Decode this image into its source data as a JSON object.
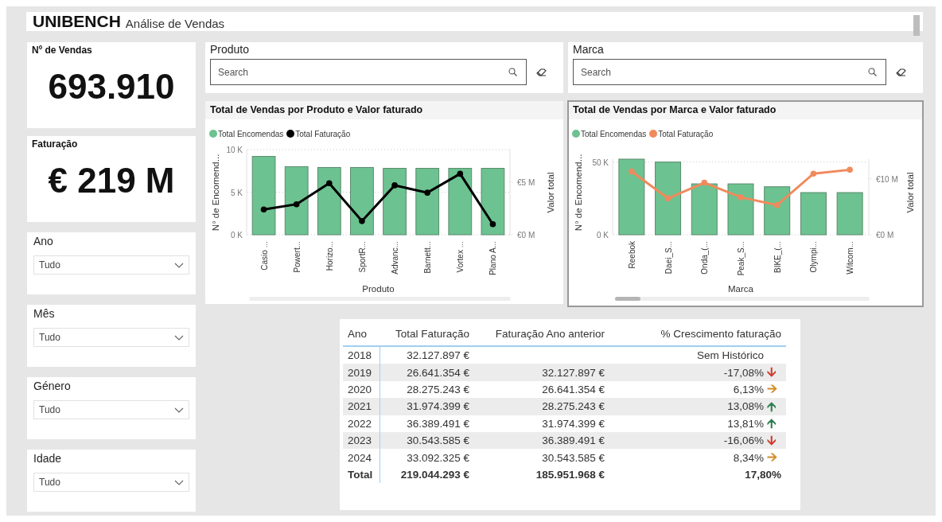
{
  "header": {
    "brand": "UNIBENCH",
    "title": "Análise de Vendas"
  },
  "cards": [
    {
      "label": "Nº de Vendas",
      "value": "693.910"
    },
    {
      "label": "Faturação",
      "value": "€ 219 M"
    }
  ],
  "slicers": [
    {
      "label": "Ano",
      "value": "Tudo"
    },
    {
      "label": "Mês",
      "value": "Tudo"
    },
    {
      "label": "Género",
      "value": "Tudo"
    },
    {
      "label": "Idade",
      "value": "Tudo"
    }
  ],
  "search_slicers": [
    {
      "label": "Produto",
      "placeholder": "Search"
    },
    {
      "label": "Marca",
      "placeholder": "Search"
    }
  ],
  "charts": [
    {
      "selected": false,
      "title": "Total de Vendas por Produto e Valor faturado",
      "layers": [
        {
          "chart_data": {
            "type": "bar",
            "xlabel": "Produto",
            "ylabel": "N° de Encomend...",
            "categories": [
              "Casio ...",
              "Powert...",
              "Horizo...",
              "SportR...",
              "Advanc...",
              "Barnett...",
              "Vortex ...",
              "Plano A..."
            ],
            "ylim": [
              0,
              10000
            ],
            "yticks": [
              {
                "value": 0,
                "label": "0 K"
              },
              {
                "value": 5000,
                "label": "5 K"
              },
              {
                "value": 10000,
                "label": "10 K"
              }
            ],
            "stacked": false,
            "series": [
              {
                "name": "Total Encomendas",
                "color": "#6cc290",
                "values": [
                  9200,
                  8000,
                  7900,
                  7900,
                  7800,
                  7800,
                  7800,
                  7800
                ]
              }
            ]
          }
        },
        {
          "chart_data": {
            "type": "line",
            "ylabel": "Valor total",
            "ylim": [
              0,
              8.1
            ],
            "yticks": [
              {
                "value": 0,
                "label": "€0 M"
              },
              {
                "value": 5,
                "label": "€5 M"
              }
            ],
            "series": [
              {
                "name": "Total Faturação",
                "color": "#000000",
                "marker": "o",
                "values": [
                  2.4,
                  2.9,
                  4.9,
                  1.3,
                  4.7,
                  4.0,
                  5.8,
                  1.0
                ]
              }
            ]
          }
        }
      ]
    },
    {
      "selected": true,
      "title": "Total de Vendas por Marca e Valor faturado",
      "layers": [
        {
          "chart_data": {
            "type": "bar",
            "xlabel": "Marca",
            "ylabel": "N° de Encomend...",
            "categories": [
              "Reebok",
              "Daei_S...",
              "Onda_(...",
              "Peak_S...",
              "BIKE_(...",
              "Olympi...",
              "Witcom..."
            ],
            "ylim": [
              0,
              52000
            ],
            "yticks": [
              {
                "value": 0,
                "label": "0 K"
              },
              {
                "value": 50000,
                "label": "50 K"
              }
            ],
            "stacked": false,
            "series": [
              {
                "name": "Total Encomendas",
                "color": "#6cc290",
                "values": [
                  52000,
                  50000,
                  35000,
                  35000,
                  33000,
                  29000,
                  29000
                ]
              }
            ]
          }
        },
        {
          "chart_data": {
            "type": "line",
            "ylabel": "Valor total",
            "ylim": [
              0,
              13.5
            ],
            "yticks": [
              {
                "value": 0,
                "label": "€0 M"
              },
              {
                "value": 10,
                "label": "€10 M"
              }
            ],
            "series": [
              {
                "name": "Total Faturação",
                "color": "#f08a5d",
                "marker": "o",
                "values": [
                  11.3,
                  6.5,
                  9.3,
                  6.7,
                  5.3,
                  10.9,
                  11.6
                ]
              }
            ]
          }
        }
      ]
    }
  ],
  "table": {
    "columns": [
      "Ano",
      "Total Faturação",
      "Faturação Ano anterior",
      "% Crescimento faturação"
    ],
    "rows": [
      {
        "cells": [
          "2018",
          "32.127.897 €",
          "",
          "Sem Histórico"
        ]
      },
      {
        "cells": [
          "2019",
          "26.641.354 €",
          "32.127.897 €",
          "-17,08%"
        ],
        "arrow": "🡫",
        "color": "#d03a2c"
      },
      {
        "cells": [
          "2020",
          "28.275.243 €",
          "26.641.354 €",
          "6,13%"
        ],
        "arrow": "🡪",
        "color": "#d08f2c"
      },
      {
        "cells": [
          "2021",
          "31.974.399 €",
          "28.275.243 €",
          "13,08%"
        ],
        "arrow": "🡩",
        "color": "#2e7d4f"
      },
      {
        "cells": [
          "2022",
          "36.389.491 €",
          "31.974.399 €",
          "13,81%"
        ],
        "arrow": "🡩",
        "color": "#2e7d4f"
      },
      {
        "cells": [
          "2023",
          "30.543.585 €",
          "36.389.491 €",
          "-16,06%"
        ],
        "arrow": "🡫",
        "color": "#d03a2c"
      },
      {
        "cells": [
          "2024",
          "33.092.325 €",
          "30.543.585 €",
          "8,34%"
        ],
        "arrow": "🡪",
        "color": "#d08f2c"
      }
    ],
    "total": [
      "Total",
      "219.044.293 €",
      "185.951.968 €",
      "17,80%"
    ]
  }
}
